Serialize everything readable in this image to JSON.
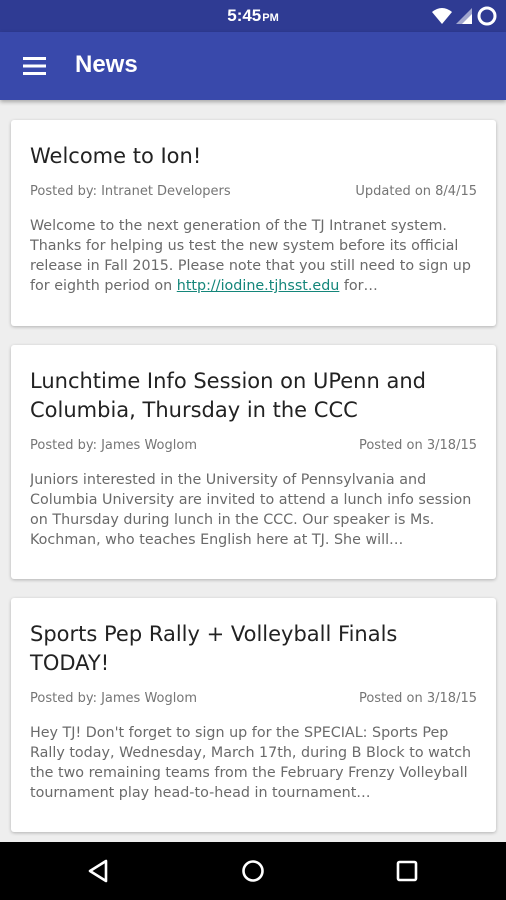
{
  "status_bar": {
    "time": "5:45",
    "ampm": "PM",
    "icons": [
      "wifi-icon",
      "signal-icon",
      "battery-icon"
    ]
  },
  "app_bar": {
    "title": "News",
    "menu_icon": "hamburger-menu-icon",
    "color": "#3949ab",
    "status_color": "#2f3b93"
  },
  "posts": [
    {
      "title": "Welcome to Ion!",
      "author": "Posted by: Intranet Developers",
      "date": "Updated on 8/4/15",
      "body_before_link": "Welcome to the next generation of the TJ Intranet system. Thanks for helping us test the new system before its official release in Fall 2015. Please note that you still need to sign up for eighth period on ",
      "link": "http://iodine.tjhsst.edu",
      "body_after_link": " for…"
    },
    {
      "title": "Lunchtime Info Session on UPenn and Columbia, Thursday in the CCC",
      "author": "Posted by: James Woglom",
      "date": "Posted on 3/18/15",
      "body": "Juniors interested in the University of Pennsylvania and Columbia University are invited to attend a lunch info session on Thursday during lunch in the CCC. Our speaker is Ms. Kochman, who teaches English here at TJ. She will…"
    },
    {
      "title": "Sports Pep Rally + Volleyball Finals TODAY!",
      "author": "Posted by: James Woglom",
      "date": "Posted on 3/18/15",
      "body": "Hey TJ! Don't forget to sign up for the SPECIAL: Sports Pep Rally today, Wednesday, March 17th, during B Block to watch the two remaining teams from the February Frenzy Volleyball tournament play head-to-head in tournament…"
    }
  ],
  "link_color": "#14867a",
  "nav_bar": {
    "icons": [
      "back-icon",
      "home-icon",
      "recents-icon"
    ]
  }
}
